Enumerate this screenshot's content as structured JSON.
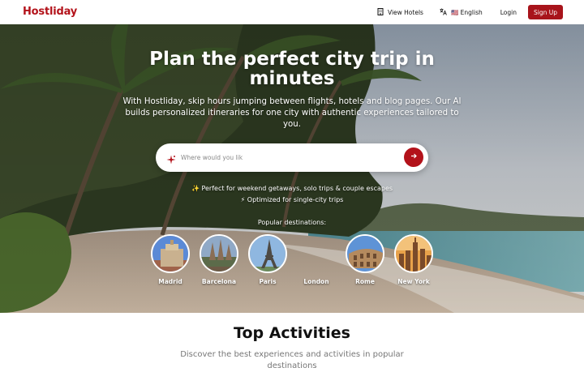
{
  "header": {
    "logo": "Hostliday",
    "view_hotels": "View Hotels",
    "language": "🇺🇸 English",
    "login": "Login",
    "signup": "Sign Up"
  },
  "hero": {
    "title": "Plan the perfect city trip in minutes",
    "subtitle": "With Hostliday, skip hours jumping between flights, hotels and blog pages. Our AI builds personalized itineraries for one city with authentic experiences tailored to you.",
    "search_placeholder": "Where would you lik",
    "hint1": "✨ Perfect for weekend getaways, solo trips & couple escapes",
    "hint2": "⚡ Optimized for single-city trips",
    "popular_label": "Popular destinations:",
    "destinations": [
      {
        "name": "Madrid"
      },
      {
        "name": "Barcelona"
      },
      {
        "name": "Paris"
      },
      {
        "name": "London"
      },
      {
        "name": "Rome"
      },
      {
        "name": "New York"
      }
    ]
  },
  "section": {
    "title": "Top Activities",
    "subtitle": "Discover the best experiences and activities in popular destinations"
  },
  "colors": {
    "brand": "#b3121a",
    "signup_bg": "#a8141b"
  },
  "icons": {
    "view_hotels": "building-icon",
    "language": "translate-icon",
    "search": "sparkle-icon",
    "submit": "arrow-right-icon"
  }
}
